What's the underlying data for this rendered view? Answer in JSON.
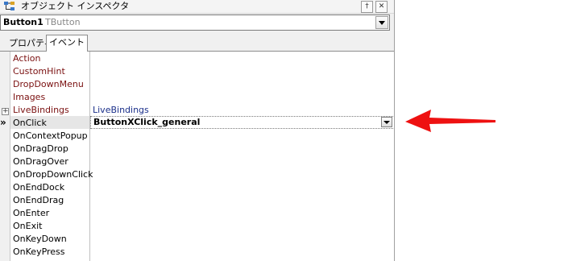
{
  "window": {
    "title": "オブジェクト インスペクタ",
    "pin_glyph": "†",
    "close_glyph": "✕"
  },
  "selector": {
    "name": "Button1",
    "type": "TButton"
  },
  "tabs": [
    {
      "label": "プロパティ",
      "active": false
    },
    {
      "label": "イベント",
      "active": true
    }
  ],
  "events": [
    {
      "name": "Action",
      "value": "",
      "special": true
    },
    {
      "name": "CustomHint",
      "value": "",
      "special": true
    },
    {
      "name": "DropDownMenu",
      "value": "",
      "special": true
    },
    {
      "name": "Images",
      "value": "",
      "special": true
    },
    {
      "name": "LiveBindings",
      "value": "LiveBindings",
      "special": true,
      "expandable": true
    },
    {
      "name": "OnClick",
      "value": "ButtonXClick_general",
      "selected": true
    },
    {
      "name": "OnContextPopup",
      "value": ""
    },
    {
      "name": "OnDragDrop",
      "value": ""
    },
    {
      "name": "OnDragOver",
      "value": ""
    },
    {
      "name": "OnDropDownClick",
      "value": ""
    },
    {
      "name": "OnEndDock",
      "value": ""
    },
    {
      "name": "OnEndDrag",
      "value": ""
    },
    {
      "name": "OnEnter",
      "value": ""
    },
    {
      "name": "OnExit",
      "value": ""
    },
    {
      "name": "OnKeyDown",
      "value": ""
    },
    {
      "name": "OnKeyPress",
      "value": ""
    }
  ],
  "gutter": {
    "selected_marker": "»",
    "expand_glyph": "+"
  },
  "colors": {
    "special_name": "#7a1010",
    "link_value": "#1a2f8a",
    "annotation_arrow": "#ee1111"
  }
}
